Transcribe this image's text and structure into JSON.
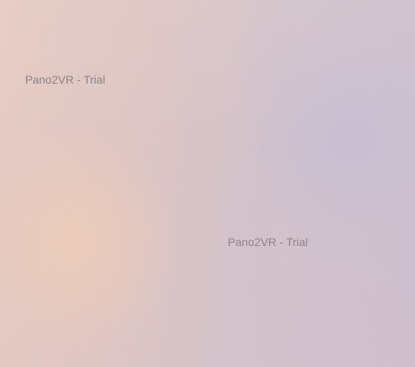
{
  "panorama": {
    "watermarks": [
      {
        "text": "Pano2VR - Trial"
      },
      {
        "text": "Pano2VR - Trial"
      }
    ]
  },
  "colors": {
    "sky_left": "#e5cbc3",
    "sky_mid": "#d2c3cb",
    "sky_right": "#cbc0cf",
    "glow_warm": "#eecdb8",
    "watermark_text": "#8e8386"
  }
}
